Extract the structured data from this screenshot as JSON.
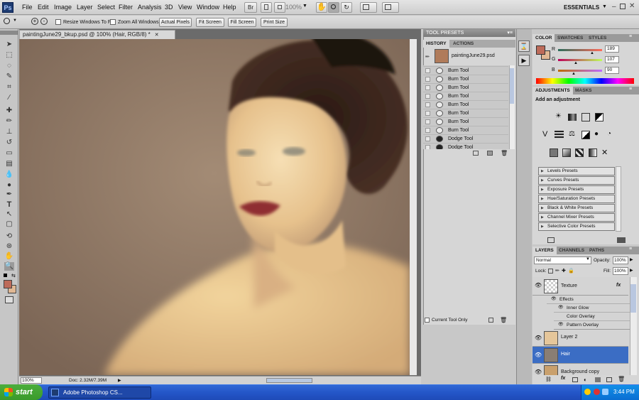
{
  "app": {
    "logo": "Ps"
  },
  "menu": [
    "File",
    "Edit",
    "Image",
    "Layer",
    "Select",
    "Filter",
    "Analysis",
    "3D",
    "View",
    "Window",
    "Help"
  ],
  "toolbar": {
    "br": "Br",
    "zoom": "100%",
    "workspace": "ESSENTIALS"
  },
  "options": {
    "resize_label": "Resize Windows To Fit",
    "zoom_all_label": "Zoom All Windows",
    "actual_pixels": "Actual Pixels",
    "fit_screen": "Fit Screen",
    "fill_screen": "Fill Screen",
    "print_size": "Print Size"
  },
  "document": {
    "tab_title": "paintingJune29_bkup.psd @ 100% (Hair, RGB/8) *",
    "zoom": "100%",
    "doc_size": "Doc: 2.32M/7.39M"
  },
  "tool_presets": {
    "title": "TOOL PRESETS"
  },
  "history": {
    "tabs": [
      "HISTORY",
      "ACTIONS"
    ],
    "snapshot": "paintingJune29.psd",
    "items": [
      "Burn Tool",
      "Burn Tool",
      "Burn Tool",
      "Burn Tool",
      "Burn Tool",
      "Burn Tool",
      "Burn Tool",
      "Burn Tool",
      "Dodge Tool",
      "Dodge Tool"
    ],
    "current_tool_only": "Current Tool Only"
  },
  "color": {
    "tabs": [
      "COLOR",
      "SWATCHES",
      "STYLES"
    ],
    "r_label": "R",
    "g_label": "G",
    "b_label": "B",
    "r": "189",
    "g": "107",
    "b": "90",
    "fg": "#bd6b5a",
    "bg": "#e0b894"
  },
  "adjustments": {
    "tabs": [
      "ADJUSTMENTS",
      "MASKS"
    ],
    "title": "Add an adjustment",
    "presets": [
      "Levels Presets",
      "Curves Presets",
      "Exposure Presets",
      "Hue/Saturation Presets",
      "Black & White Presets",
      "Channel Mixer Presets",
      "Selective Color Presets"
    ]
  },
  "layers": {
    "tabs": [
      "LAYERS",
      "CHANNELS",
      "PATHS"
    ],
    "blend": "Normal",
    "opacity_label": "Opacity:",
    "opacity": "100%",
    "lock_label": "Lock:",
    "fill_label": "Fill:",
    "fill": "100%",
    "texture": "Texture",
    "fx": "fx",
    "effects_label": "Effects",
    "effects": [
      "Inner Glow",
      "Color Overlay",
      "Pattern Overlay"
    ],
    "layer2": "Layer 2",
    "hair": "Hair",
    "background_copy": "Background copy"
  },
  "taskbar": {
    "start": "start",
    "task": "Adobe Photoshop CS...",
    "clock": "3:44 PM"
  }
}
